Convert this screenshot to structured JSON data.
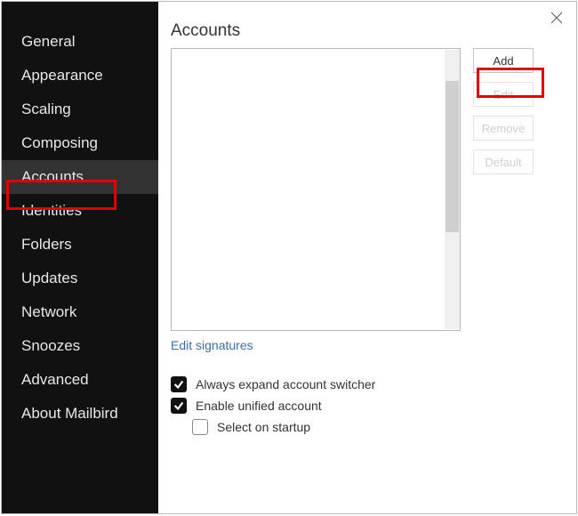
{
  "sidebar": {
    "items": [
      {
        "label": "General"
      },
      {
        "label": "Appearance"
      },
      {
        "label": "Scaling"
      },
      {
        "label": "Composing"
      },
      {
        "label": "Accounts"
      },
      {
        "label": "Identities"
      },
      {
        "label": "Folders"
      },
      {
        "label": "Updates"
      },
      {
        "label": "Network"
      },
      {
        "label": "Snoozes"
      },
      {
        "label": "Advanced"
      },
      {
        "label": "About Mailbird"
      }
    ],
    "activeIndex": 4
  },
  "main": {
    "heading": "Accounts",
    "buttons": {
      "add": "Add",
      "edit": "Edit",
      "remove": "Remove",
      "default": "Default"
    },
    "editSignatures": "Edit signatures",
    "options": {
      "alwaysExpand": "Always expand account switcher",
      "enableUnified": "Enable unified account",
      "selectOnStartup": "Select on startup"
    }
  }
}
